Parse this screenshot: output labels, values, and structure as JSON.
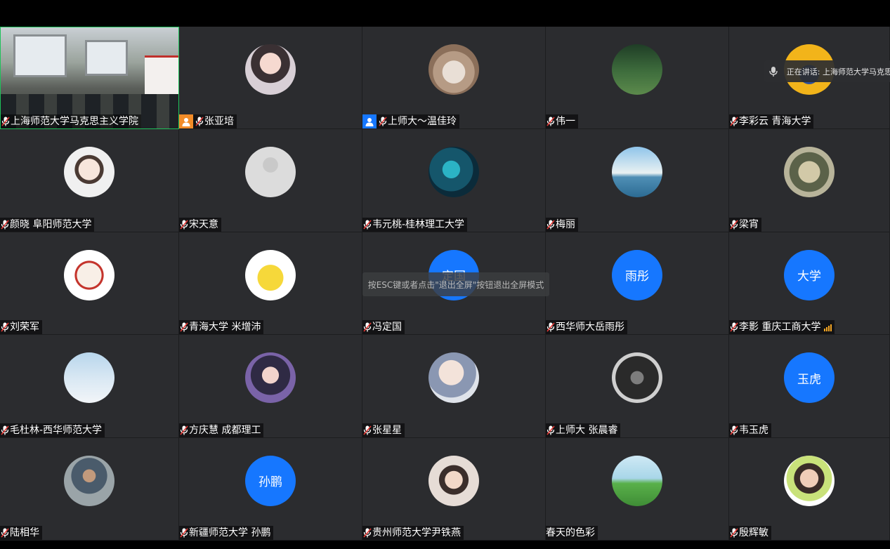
{
  "speaking_indicator": {
    "text": "正在讲话: 上海师范大学马克思"
  },
  "esc_hint": "按ESC键或者点击\"退出全屏\"按钮退出全屏模式",
  "colors": {
    "tile_bg": "#2b2c2f",
    "accent_blue": "#1677ff",
    "video_border": "#1ec25a",
    "host_orange": "#f28c28"
  },
  "participants": [
    {
      "name": "上海师范大学马克思主义学院",
      "avatar": "video-feed"
    },
    {
      "name": "张亚培",
      "avatar": "anime-girl",
      "role": "host"
    },
    {
      "name": "上师大～温佳玲",
      "avatar": "cat",
      "role": "cohost"
    },
    {
      "name": "伟一",
      "avatar": "forest"
    },
    {
      "name": "李彩云 青海大学",
      "avatar": "yellow-cartoon"
    },
    {
      "name": "颜晓  阜阳师范大学",
      "avatar": "fox-boy"
    },
    {
      "name": "宋天意",
      "avatar": "default-silhouette"
    },
    {
      "name": "韦元桃-桂林理工大学",
      "avatar": "blue-fish"
    },
    {
      "name": "梅丽",
      "avatar": "sea-cliff"
    },
    {
      "name": "梁宵",
      "avatar": "anime-headphones"
    },
    {
      "name": "刘荣军",
      "avatar": "cartoon-badge"
    },
    {
      "name": "青海大学 米增沛",
      "avatar": "pikachu"
    },
    {
      "name": "冯定国",
      "avatar": "text",
      "avatar_text": "定国"
    },
    {
      "name": "西华师大岳雨彤",
      "avatar": "text",
      "avatar_text": "雨彤"
    },
    {
      "name": "李影 重庆工商大学",
      "avatar": "text",
      "avatar_text": "大学",
      "signal": true
    },
    {
      "name": "毛杜林-西华师范大学",
      "avatar": "sky-tree"
    },
    {
      "name": "方庆慧 成都理工",
      "avatar": "flower-girl"
    },
    {
      "name": "张星星",
      "avatar": "girl-drawing"
    },
    {
      "name": "上师大 张晨睿",
      "avatar": "dark-figure"
    },
    {
      "name": "韦玉虎",
      "avatar": "text",
      "avatar_text": "玉虎"
    },
    {
      "name": "陆相华",
      "avatar": "man-photo"
    },
    {
      "name": "新疆师范大学 孙鹏",
      "avatar": "text",
      "avatar_text": "孙鹏"
    },
    {
      "name": "贵州师范大学尹铁燕",
      "avatar": "child-photo"
    },
    {
      "name": "春天的色彩",
      "avatar": "spring-scene",
      "no_mic": true
    },
    {
      "name": "殷辉敏",
      "avatar": "woman-portrait"
    }
  ]
}
